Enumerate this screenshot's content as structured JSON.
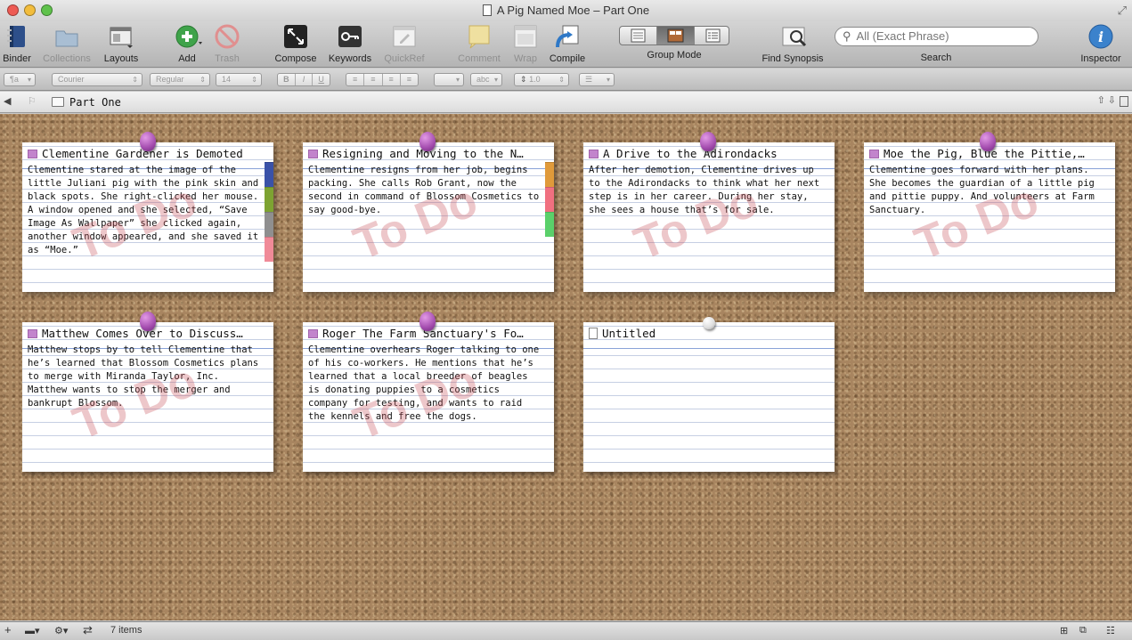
{
  "window": {
    "title": "A Pig Named Moe – Part One"
  },
  "traffic_lights": {
    "close": "#ee5b54",
    "minimize": "#f2bd3d",
    "zoom": "#5fc24b"
  },
  "toolbar": {
    "binder": "Binder",
    "collections": "Collections",
    "layouts": "Layouts",
    "add": "Add",
    "trash": "Trash",
    "compose": "Compose",
    "keywords": "Keywords",
    "quickref": "QuickRef",
    "comment": "Comment",
    "wrap": "Wrap",
    "compile": "Compile",
    "group_mode": "Group Mode",
    "find_synopsis": "Find Synopsis",
    "search_label": "Search",
    "search_placeholder": "All (Exact Phrase)",
    "inspector": "Inspector"
  },
  "format_bar": {
    "paragraph": "¶a",
    "font": "Courier",
    "style": "Regular",
    "size": "14",
    "bold": "B",
    "italic": "I",
    "underline": "U",
    "highlight": "abc",
    "line_spacing": "1.0"
  },
  "header": {
    "breadcrumb": "Part One"
  },
  "cards": [
    {
      "title": "Clementine Gardener is Demoted",
      "icon": "document-icon",
      "text": "Clementine stared at the image of the little Juliani pig with the pink skin and black spots. She right-clicked her mouse. A window opened and she selected, “Save Image As Wallpaper” she clicked again, another window appeared, and she saved it as “Moe.”",
      "stamp": "To Do",
      "labels": [
        "#3a52a8",
        "#7da332",
        "#8f8f8f",
        "#f08a98"
      ]
    },
    {
      "title": "Resigning and Moving to the N…",
      "icon": "document-icon",
      "text": "Clementine resigns from her job, begins packing. She calls Rob Grant, now the second in command of Blossom Cosmetics to say good-bye.",
      "stamp": "To Do",
      "labels": [
        "#e09a3a",
        "#f07080",
        "#5ad06a"
      ]
    },
    {
      "title": "A Drive to the Adirondacks",
      "icon": "document-icon",
      "text": "After her demotion, Clementine drives up to the Adirondacks to think what her next step is in her career. During her stay, she sees a house that’s for sale.",
      "stamp": "To Do",
      "labels": []
    },
    {
      "title": "Moe the Pig, Blue the Pittie,…",
      "icon": "document-icon",
      "text": "Clementine goes forward with her plans. She becomes the guardian of a little pig and pittie puppy. And volunteers at Farm Sanctuary.",
      "stamp": "To Do",
      "labels": []
    },
    {
      "title": "Matthew Comes Over to Discuss…",
      "icon": "document-icon",
      "text": "Matthew stops by to tell Clementine that he’s learned that Blossom Cosmetics plans to merge with Miranda Taylor, Inc. Matthew wants to stop the merger and bankrupt Blossom.",
      "stamp": "To Do",
      "labels": []
    },
    {
      "title": "Roger The Farm Sanctuary's Fo…",
      "icon": "document-icon",
      "text": "Clementine overhears Roger talking to one of his co-workers. He mentions that he’s learned that a local breeder of beagles is donating puppies to a cosmetics company for testing, and wants to raid the kennels and free the dogs.",
      "stamp": "To Do",
      "labels": []
    },
    {
      "title": "Untitled",
      "icon": "blank-document-icon",
      "text": "",
      "stamp": "",
      "labels": []
    }
  ],
  "status": {
    "items_count": "7 items"
  }
}
